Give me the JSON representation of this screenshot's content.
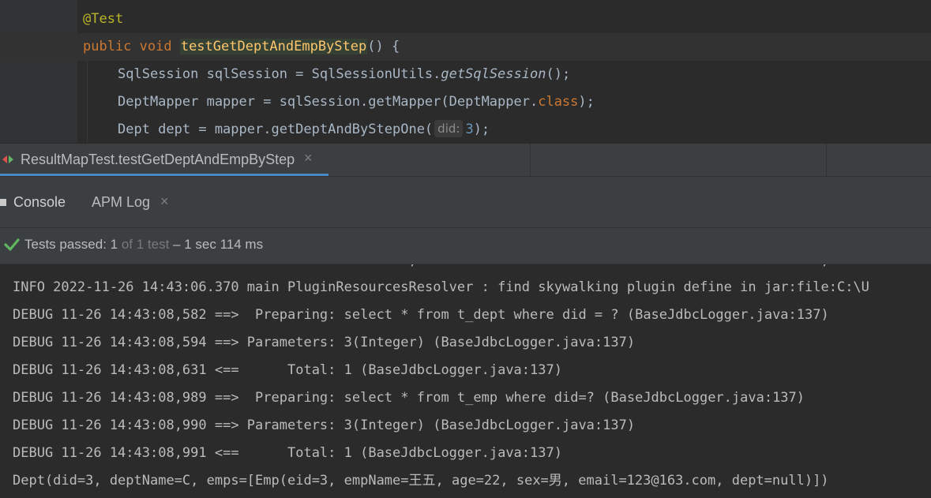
{
  "editor": {
    "annotation": "@Test",
    "method": {
      "modifiers": "public void ",
      "name": "testGetDeptAndEmpByStep",
      "suffix": "() {"
    },
    "line3": {
      "prefix": "SqlSession sqlSession = SqlSessionUtils.",
      "call": "getSqlSession",
      "suffix": "();"
    },
    "line4": {
      "prefix": "DeptMapper mapper = sqlSession.getMapper(DeptMapper.",
      "keyword": "class",
      "suffix": ");"
    },
    "line5": {
      "prefix": "Dept dept = mapper.getDeptAndByStepOne(",
      "hint": "did:",
      "arg": "3",
      "suffix": ");"
    }
  },
  "run_tab": {
    "label": "ResultMapTest.testGetDeptAndEmpByStep",
    "close": "×"
  },
  "console_tabs": {
    "console": "Console",
    "apm": "APM Log",
    "apm_close": "×"
  },
  "test_status": {
    "passed": "Tests passed: 1",
    "of": " of 1 test",
    "duration": " – 1 sec 114 ms"
  },
  "console": {
    "partial": "                                                 ,                                                  ,",
    "lines": [
      "INFO 2022-11-26 14:43:06.370 main PluginResourcesResolver : find skywalking plugin define in jar:file:C:\\U",
      "DEBUG 11-26 14:43:08,582 ==>  Preparing: select * from t_dept where did = ? (BaseJdbcLogger.java:137)",
      "DEBUG 11-26 14:43:08,594 ==> Parameters: 3(Integer) (BaseJdbcLogger.java:137)",
      "DEBUG 11-26 14:43:08,631 <==      Total: 1 (BaseJdbcLogger.java:137)",
      "DEBUG 11-26 14:43:08,989 ==>  Preparing: select * from t_emp where did=? (BaseJdbcLogger.java:137)",
      "DEBUG 11-26 14:43:08,990 ==> Parameters: 3(Integer) (BaseJdbcLogger.java:137)",
      "DEBUG 11-26 14:43:08,991 <==      Total: 1 (BaseJdbcLogger.java:137)",
      "Dept(did=3, deptName=C, emps=[Emp(eid=3, empName=王五, age=22, sex=男, email=123@163.com, dept=null)])"
    ]
  },
  "colors": {
    "editor_bg": "#2b2b2b",
    "panel_bg": "#3c3f41",
    "keyword": "#cc7832",
    "method": "#ffc66d",
    "annotation": "#bbb529",
    "number": "#6897bb",
    "pass_green": "#5fb85f",
    "tab_accent": "#4a88c7"
  },
  "icons": {
    "run_gutter": "run-test-icon",
    "bookmark": "bookmark-icon",
    "bulb": "intention-bulb-icon",
    "check": "check-icon",
    "console": "console-icon"
  }
}
